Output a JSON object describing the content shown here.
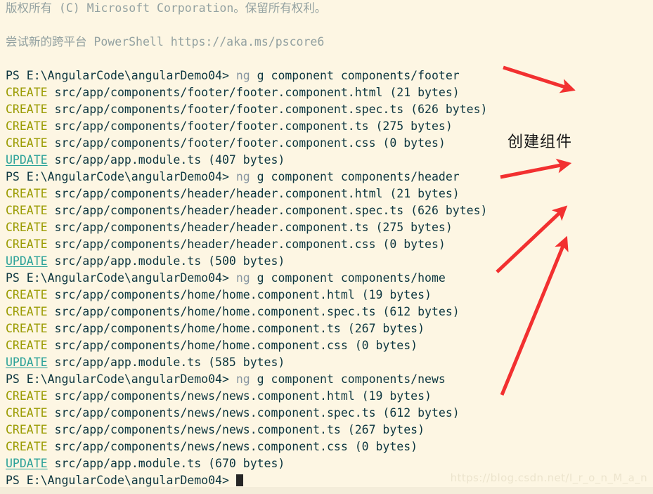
{
  "window": {
    "title": "Windows PowerShell",
    "background_color": "#fdf6e3",
    "foreground_color": "#0d3640",
    "create_color": "#9a9b00",
    "update_color": "#2aa198",
    "dim_color": "#8795a1",
    "annotation_color": "#f23030"
  },
  "console": {
    "header": [
      "版权所有 (C) Microsoft Corporation。保留所有权利。",
      "",
      "尝试新的跨平台 PowerShell https://aka.ms/pscore6",
      ""
    ],
    "lines": [
      {
        "type": "prompt",
        "prompt": "PS E:\\AngularCode\\angularDemo04> ",
        "cmd": "ng",
        "args": " g component components/footer"
      },
      {
        "type": "create",
        "tag": "CREATE",
        "text": " src/app/components/footer/footer.component.html (21 bytes)"
      },
      {
        "type": "create",
        "tag": "CREATE",
        "text": " src/app/components/footer/footer.component.spec.ts (626 bytes)"
      },
      {
        "type": "create",
        "tag": "CREATE",
        "text": " src/app/components/footer/footer.component.ts (275 bytes)"
      },
      {
        "type": "create",
        "tag": "CREATE",
        "text": " src/app/components/footer/footer.component.css (0 bytes)"
      },
      {
        "type": "update",
        "tag": "UPDATE",
        "text": " src/app/app.module.ts (407 bytes)"
      },
      {
        "type": "prompt",
        "prompt": "PS E:\\AngularCode\\angularDemo04> ",
        "cmd": "ng",
        "args": " g component components/header"
      },
      {
        "type": "create",
        "tag": "CREATE",
        "text": " src/app/components/header/header.component.html (21 bytes)"
      },
      {
        "type": "create",
        "tag": "CREATE",
        "text": " src/app/components/header/header.component.spec.ts (626 bytes)"
      },
      {
        "type": "create",
        "tag": "CREATE",
        "text": " src/app/components/header/header.component.ts (275 bytes)"
      },
      {
        "type": "create",
        "tag": "CREATE",
        "text": " src/app/components/header/header.component.css (0 bytes)"
      },
      {
        "type": "update",
        "tag": "UPDATE",
        "text": " src/app/app.module.ts (500 bytes)"
      },
      {
        "type": "prompt",
        "prompt": "PS E:\\AngularCode\\angularDemo04> ",
        "cmd": "ng",
        "args": " g component components/home"
      },
      {
        "type": "create",
        "tag": "CREATE",
        "text": " src/app/components/home/home.component.html (19 bytes)"
      },
      {
        "type": "create",
        "tag": "CREATE",
        "text": " src/app/components/home/home.component.spec.ts (612 bytes)"
      },
      {
        "type": "create",
        "tag": "CREATE",
        "text": " src/app/components/home/home.component.ts (267 bytes)"
      },
      {
        "type": "create",
        "tag": "CREATE",
        "text": " src/app/components/home/home.component.css (0 bytes)"
      },
      {
        "type": "update",
        "tag": "UPDATE",
        "text": " src/app/app.module.ts (585 bytes)"
      },
      {
        "type": "prompt",
        "prompt": "PS E:\\AngularCode\\angularDemo04> ",
        "cmd": "ng",
        "args": " g component components/news"
      },
      {
        "type": "create",
        "tag": "CREATE",
        "text": " src/app/components/news/news.component.html (19 bytes)"
      },
      {
        "type": "create",
        "tag": "CREATE",
        "text": " src/app/components/news/news.component.spec.ts (612 bytes)"
      },
      {
        "type": "create",
        "tag": "CREATE",
        "text": " src/app/components/news/news.component.ts (267 bytes)"
      },
      {
        "type": "create",
        "tag": "CREATE",
        "text": " src/app/components/news/news.component.css (0 bytes)"
      },
      {
        "type": "update",
        "tag": "UPDATE",
        "text": " src/app/app.module.ts (670 bytes)"
      },
      {
        "type": "cursor",
        "prompt": "PS E:\\AngularCode\\angularDemo04> "
      }
    ]
  },
  "annotations": {
    "label": "创建组件",
    "arrow_count": 4
  },
  "watermark": {
    "text": "https://blog.csdn.net/I_r_o_n_M_a_n"
  }
}
